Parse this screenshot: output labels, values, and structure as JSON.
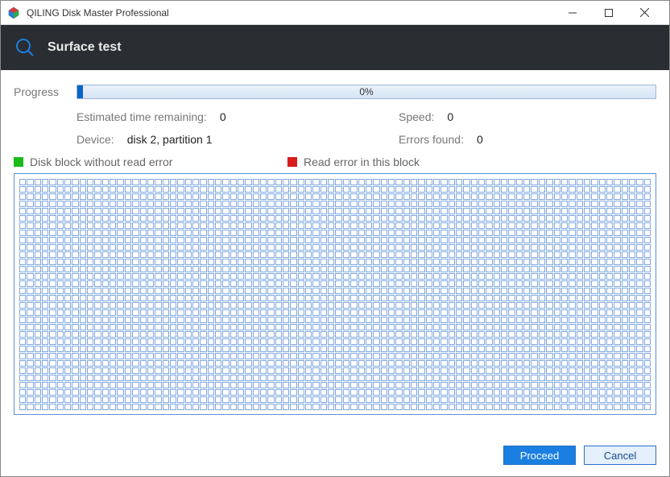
{
  "window": {
    "title": "QILING Disk Master Professional"
  },
  "header": {
    "title": "Surface test"
  },
  "progress": {
    "label": "Progress",
    "percent_text": "0%"
  },
  "info": {
    "eta_label": "Estimated time remaining:",
    "eta_value": "0",
    "speed_label": "Speed:",
    "speed_value": "0",
    "device_label": "Device:",
    "device_value": "disk 2, partition 1",
    "errors_label": "Errors found:",
    "errors_value": "0"
  },
  "legend": {
    "ok_label": "Disk block without read error",
    "err_label": "Read error in this block"
  },
  "buttons": {
    "proceed": "Proceed",
    "cancel": "Cancel"
  },
  "colors": {
    "legend_ok": "#1abb1a",
    "legend_err": "#d91c1c",
    "accent": "#1a7fe0"
  }
}
